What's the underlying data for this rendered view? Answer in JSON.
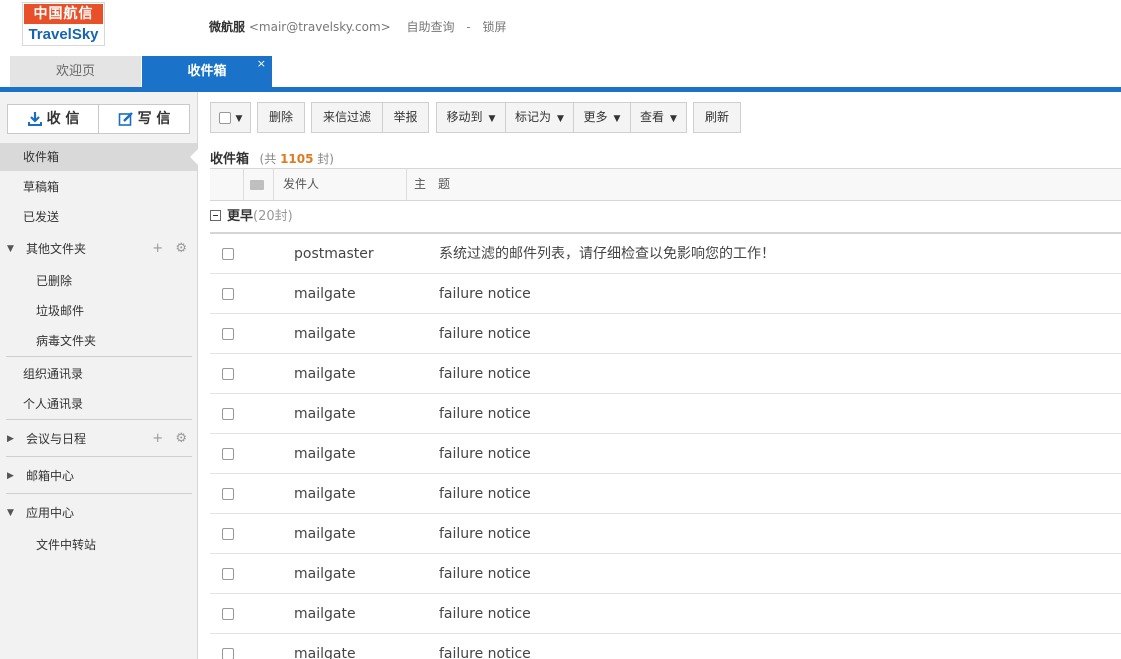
{
  "header": {
    "logo_top": "中国航信",
    "logo_bottom": "TravelSky",
    "user_name": "微航服",
    "user_email": "<mair@travelsky.com>",
    "link_selfservice": "自助查询",
    "separator": "-",
    "link_lock": "锁屏"
  },
  "tabs": {
    "welcome": "欢迎页",
    "inbox": "收件箱",
    "close": "×"
  },
  "sidebar": {
    "receive_label": "收 信",
    "compose_label": "写 信",
    "items": {
      "inbox": "收件箱",
      "drafts": "草稿箱",
      "sent": "已发送",
      "other_folders": "其他文件夹",
      "deleted": "已删除",
      "junk": "垃圾邮件",
      "virus": "病毒文件夹",
      "org_contacts": "组织通讯录",
      "personal_contacts": "个人通讯录",
      "meetings": "会议与日程",
      "mailbox_center": "邮箱中心",
      "app_center": "应用中心",
      "file_transfer": "文件中转站"
    },
    "add_glyph": "+",
    "gear_glyph": "⚙",
    "caret_down": "▼",
    "caret_right": "▶"
  },
  "toolbar": {
    "delete": "删除",
    "filter": "来信过滤",
    "report": "举报",
    "move_to": "移动到",
    "mark_as": "标记为",
    "more": "更多",
    "view": "查看",
    "refresh": "刷新",
    "arrow": "▼"
  },
  "list": {
    "title": "收件箱",
    "count_prefix": "(共",
    "count": "1105",
    "count_suffix": "封)",
    "col_sender": "发件人",
    "col_subject": "主　题",
    "group_label": "更早",
    "group_count": "(20封)",
    "rows": [
      {
        "sender": "postmaster",
        "subject": "系统过滤的邮件列表，请仔细检查以免影响您的工作！"
      },
      {
        "sender": "mailgate",
        "subject": "failure notice"
      },
      {
        "sender": "mailgate",
        "subject": "failure notice"
      },
      {
        "sender": "mailgate",
        "subject": "failure notice"
      },
      {
        "sender": "mailgate",
        "subject": "failure notice"
      },
      {
        "sender": "mailgate",
        "subject": "failure notice"
      },
      {
        "sender": "mailgate",
        "subject": "failure notice"
      },
      {
        "sender": "mailgate",
        "subject": "failure notice"
      },
      {
        "sender": "mailgate",
        "subject": "failure notice"
      },
      {
        "sender": "mailgate",
        "subject": "failure notice"
      },
      {
        "sender": "mailgate",
        "subject": "failure notice"
      }
    ]
  },
  "colors": {
    "accent": "#1a73c8",
    "logo_red": "#e8502a",
    "count_orange": "#e07a1f"
  }
}
